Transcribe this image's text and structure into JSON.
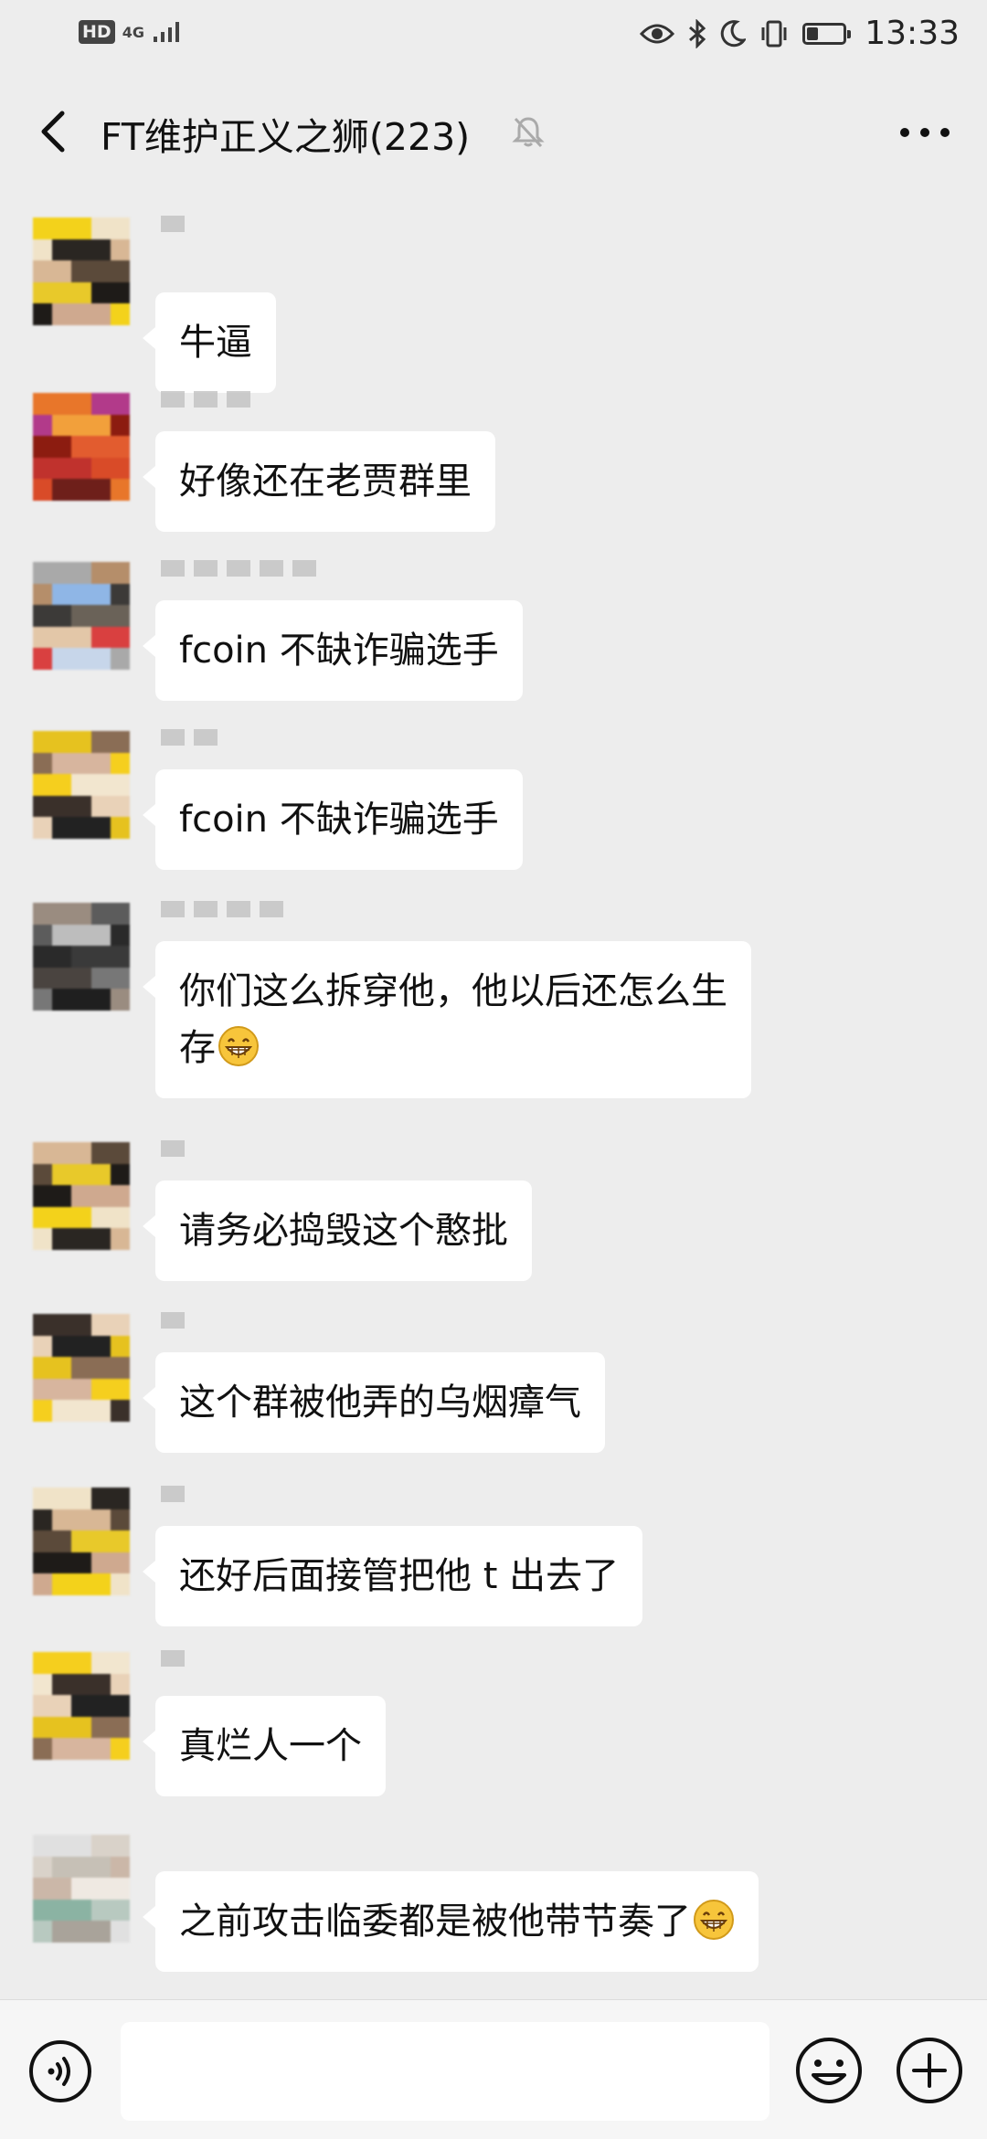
{
  "status_bar": {
    "hd_badge": "HD",
    "network": "4G",
    "time": "13:33",
    "battery_level": 0.3
  },
  "chat": {
    "title": "FT维护正义之狮(223)",
    "muted": true
  },
  "messages": [
    {
      "text": "牛逼"
    },
    {
      "text": "好像还在老贾群里"
    },
    {
      "text": "fcoin 不缺诈骗选手"
    },
    {
      "text": "fcoin 不缺诈骗选手"
    },
    {
      "line1": "你们这么拆穿他，他以后还怎么生",
      "line2": "存"
    },
    {
      "text": "请务必捣毁这个憨批"
    },
    {
      "text": "这个群被他弄的乌烟瘴气"
    },
    {
      "text": "还好后面接管把他 t 出去了"
    },
    {
      "text": "真烂人一个"
    },
    {
      "text": "之前攻击临委都是被他带节奏了"
    }
  ],
  "input": {
    "value": ""
  },
  "icons": {
    "back": "back-arrow-icon",
    "mute": "bell-off-icon",
    "more": "more-dots-icon",
    "voice": "voice-icon",
    "emoji": "emoji-icon",
    "plus": "plus-icon"
  },
  "colors": {
    "background": "#ededed",
    "bubble": "#ffffff",
    "input_bar": "#f6f6f6"
  }
}
